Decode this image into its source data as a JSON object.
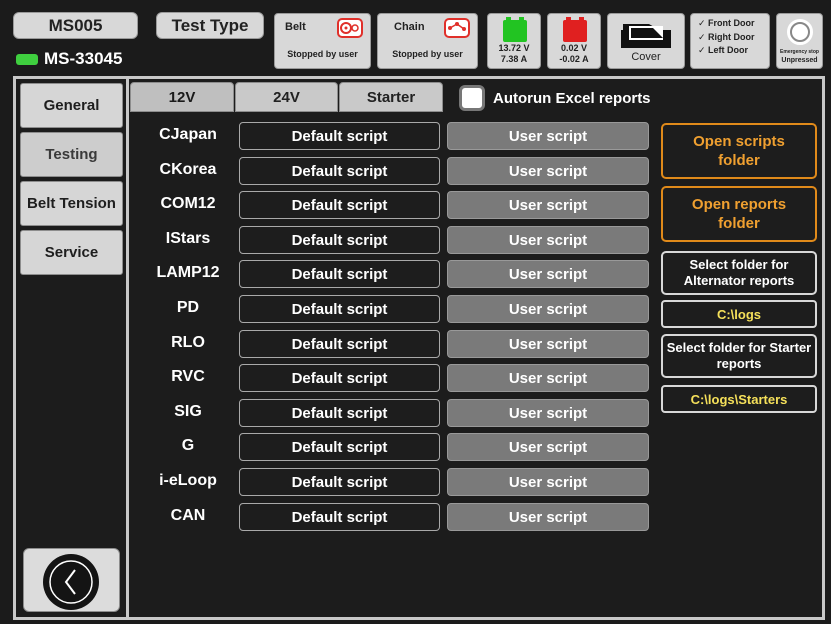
{
  "header": {
    "model": "MS005",
    "test_type_label": "Test Type",
    "serial": "MS-33045",
    "belt": {
      "title": "Belt",
      "status": "Stopped by user"
    },
    "chain": {
      "title": "Chain",
      "status": "Stopped by user"
    },
    "battery_12v": {
      "voltage": "13.72 V",
      "current": "7.38 A",
      "color": "#22c422"
    },
    "battery_24v": {
      "voltage": "0.02 V",
      "current": "-0.02 A",
      "color": "#e02020"
    },
    "cover_label": "Cover",
    "doors": [
      "✓ Front Door",
      "✓ Right Door",
      "✓ Left Door"
    ],
    "emergency": {
      "label": "Emergency stop",
      "state": "Unpressed"
    }
  },
  "sidebar": {
    "items": [
      {
        "label": "General"
      },
      {
        "label": "Testing"
      },
      {
        "label": "Belt Tension"
      },
      {
        "label": "Service"
      }
    ],
    "active": "Testing"
  },
  "tabs": [
    {
      "label": "12V"
    },
    {
      "label": "24V"
    },
    {
      "label": "Starter"
    }
  ],
  "active_tab": "12V",
  "autorun_label": "Autorun Excel reports",
  "autorun_checked": false,
  "default_label": "Default script",
  "user_label": "User script",
  "rows": [
    {
      "name": "CJapan"
    },
    {
      "name": "CKorea"
    },
    {
      "name": "COM12"
    },
    {
      "name": "IStars"
    },
    {
      "name": "LAMP12"
    },
    {
      "name": "PD"
    },
    {
      "name": "RLO"
    },
    {
      "name": "RVC"
    },
    {
      "name": "SIG"
    },
    {
      "name": "G"
    },
    {
      "name": "i-eLoop"
    },
    {
      "name": "CAN"
    }
  ],
  "right_panel": {
    "open_scripts": "Open scripts folder",
    "open_reports": "Open reports folder",
    "select_alt": "Select folder for Alternator reports",
    "alt_path": "C:\\logs",
    "select_starter": "Select folder for Starter reports",
    "starter_path": "C:\\logs\\Starters"
  },
  "colors": {
    "accent_orange": "#e08a1a",
    "path_yellow": "#f5e05a",
    "status_led": "#3fcf3f"
  }
}
